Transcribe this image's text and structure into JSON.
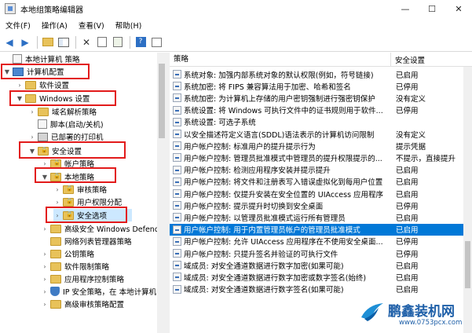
{
  "window": {
    "title": "本地组策略编辑器",
    "controls": [
      "—",
      "☐",
      "✕"
    ]
  },
  "menu": [
    "文件(F)",
    "操作(A)",
    "查看(V)",
    "帮助(H)"
  ],
  "toolbar": {
    "icons": [
      "back-icon",
      "forward-icon",
      "up-folder-icon",
      "show-hide-tree-icon",
      "delete-icon",
      "properties-icon",
      "export-list-icon",
      "help-icon",
      "filter-icon"
    ]
  },
  "tree": {
    "items": [
      {
        "label": "本地计算机 策略",
        "depth": 0
      },
      {
        "label": "计算机配置",
        "depth": 0
      },
      {
        "label": "软件设置",
        "depth": 1
      },
      {
        "label": "Windows 设置",
        "depth": 1
      },
      {
        "label": "域名解析策略",
        "depth": 2
      },
      {
        "label": "脚本(启动/关机)",
        "depth": 2
      },
      {
        "label": "已部署的打印机",
        "depth": 2
      },
      {
        "label": "安全设置",
        "depth": 2
      },
      {
        "label": "帐户策略",
        "depth": 3
      },
      {
        "label": "本地策略",
        "depth": 3
      },
      {
        "label": "审核策略",
        "depth": 4
      },
      {
        "label": "用户权限分配",
        "depth": 4
      },
      {
        "label": "安全选项",
        "depth": 4
      },
      {
        "label": "高级安全 Windows Defend",
        "depth": 3
      },
      {
        "label": "网络列表管理器策略",
        "depth": 3
      },
      {
        "label": "公钥策略",
        "depth": 3
      },
      {
        "label": "软件限制策略",
        "depth": 3
      },
      {
        "label": "应用程序控制策略",
        "depth": 3
      },
      {
        "label": "IP 安全策略，在 本地计算机",
        "depth": 3
      },
      {
        "label": "高级审核策略配置",
        "depth": 3
      }
    ]
  },
  "list": {
    "headers": {
      "policy": "策略",
      "setting": "安全设置"
    },
    "rows": [
      {
        "policy": "系统对象: 加强内部系统对象的默认权限(例如，符号链接)",
        "setting": "已启用"
      },
      {
        "policy": "系统加密: 将 FIPS 兼容算法用于加密、哈希和签名",
        "setting": "已停用"
      },
      {
        "policy": "系统加密: 为计算机上存储的用户密钥强制进行强密钥保护",
        "setting": "没有定义"
      },
      {
        "policy": "系统设置: 将 Windows 可执行文件中的证书规则用于软件...",
        "setting": "已停用"
      },
      {
        "policy": "系统设置: 可选子系统",
        "setting": ""
      },
      {
        "policy": "以安全描述符定义语言(SDDL)语法表示的计算机访问限制",
        "setting": "没有定义"
      },
      {
        "policy": "用户帐户控制: 标准用户的提升提示行为",
        "setting": "提示凭据"
      },
      {
        "policy": "用户帐户控制: 管理员批准模式中管理员的提升权限提示的...",
        "setting": "不提示，直接提升"
      },
      {
        "policy": "用户帐户控制: 检测应用程序安装并提示提升",
        "setting": "已启用"
      },
      {
        "policy": "用户帐户控制: 将文件和注册表写入错误虚拟化到每用户位置",
        "setting": "已启用"
      },
      {
        "policy": "用户帐户控制: 仅提升安装在安全位置的 UIAccess 应用程序",
        "setting": "已启用"
      },
      {
        "policy": "用户帐户控制: 提示提升时切换到安全桌面",
        "setting": "已停用"
      },
      {
        "policy": "用户帐户控制: 以管理员批准模式运行所有管理员",
        "setting": "已启用"
      },
      {
        "policy": "用户帐户控制: 用于内置管理员帐户的管理员批准模式",
        "setting": "已启用"
      },
      {
        "policy": "用户帐户控制: 允许 UIAccess 应用程序在不使用安全桌面...",
        "setting": "已停用"
      },
      {
        "policy": "用户帐户控制: 只提升签名并验证的可执行文件",
        "setting": "已停用"
      },
      {
        "policy": "域成员: 对安全通道数据进行数字加密(如果可能)",
        "setting": "已启用"
      },
      {
        "policy": "域成员: 对安全通道数据进行数字加密或数字签名(始终)",
        "setting": "已启用"
      },
      {
        "policy": "域成员: 对安全通道数据进行数字签名(如果可能)",
        "setting": "已启用"
      }
    ]
  },
  "watermark": {
    "title": "鹏鑫装机网",
    "url": "www.0753pcx.com"
  },
  "colors": {
    "selection": "#0078d7",
    "highlight_box": "#e21b1b",
    "folder": "#e8c25a",
    "watermark": "#1e5fa8"
  }
}
